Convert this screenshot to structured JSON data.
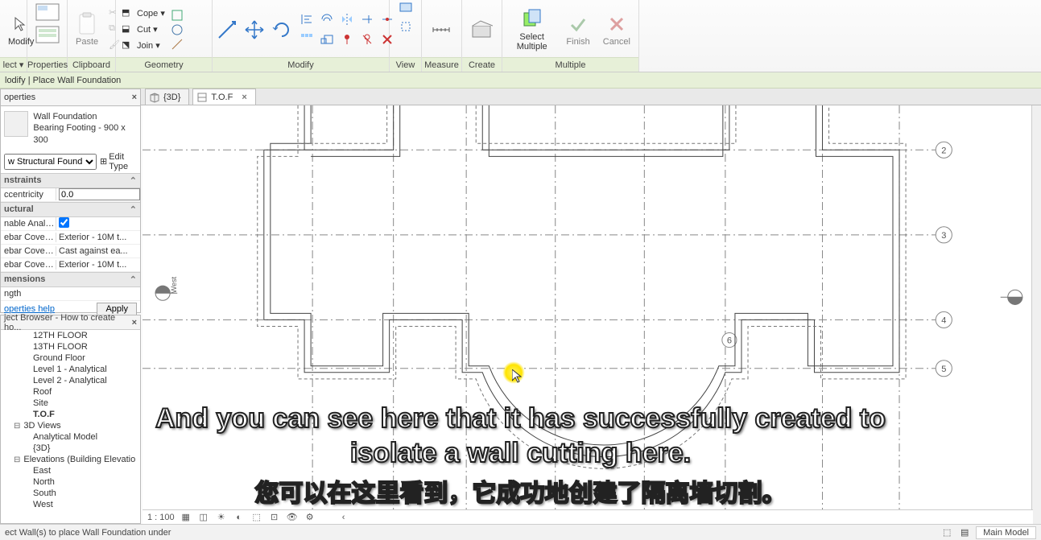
{
  "ribbon": {
    "groups": {
      "select": {
        "label": "lect ▾",
        "modify": "Modify"
      },
      "properties": {
        "label": "Properties"
      },
      "clipboard": {
        "label": "Clipboard",
        "paste": "Paste"
      },
      "geometry": {
        "label": "Geometry",
        "cope": "Cope ▾",
        "cut": "Cut ▾",
        "join": "Join ▾"
      },
      "modify": {
        "label": "Modify"
      },
      "view": {
        "label": "View"
      },
      "measure": {
        "label": "Measure"
      },
      "create": {
        "label": "Create"
      },
      "multiple": {
        "label": "Multiple",
        "select": "Select Multiple",
        "finish": "Finish",
        "cancel": "Cancel"
      }
    }
  },
  "context": "lodify | Place Wall Foundation",
  "tabs": [
    {
      "label": "{3D}",
      "icon": "cube",
      "active": false,
      "closable": false
    },
    {
      "label": "T.O.F",
      "icon": "plan",
      "active": true,
      "closable": true
    }
  ],
  "properties_panel": {
    "title": "operties",
    "type_name": "Wall Foundation",
    "type_sub": "Bearing Footing - 900 x 300",
    "selector": "w Structural Found",
    "edit_type": "Edit Type",
    "categories": [
      {
        "name": "nstraints",
        "rows": [
          {
            "k": "ccentricity",
            "v": "0.0",
            "input": true
          }
        ]
      },
      {
        "name": "uctural",
        "rows": [
          {
            "k": "nable Analyti...",
            "v": "",
            "checkbox": true,
            "checked": true
          },
          {
            "k": "ebar Cover - ...",
            "v": "Exterior - 10M t..."
          },
          {
            "k": "ebar Cover - ...",
            "v": "Cast against ea..."
          },
          {
            "k": "ebar Cover - ...",
            "v": "Exterior - 10M t..."
          }
        ]
      },
      {
        "name": "mensions",
        "rows": [
          {
            "k": "ngth",
            "v": ""
          }
        ]
      }
    ],
    "help": "operties help",
    "apply": "Apply"
  },
  "browser": {
    "title": "ject Browser - How to create ho...",
    "items": [
      {
        "type": "item",
        "label": "12TH FLOOR"
      },
      {
        "type": "item",
        "label": "13TH FLOOR"
      },
      {
        "type": "item",
        "label": "Ground Floor"
      },
      {
        "type": "item",
        "label": "Level 1 - Analytical"
      },
      {
        "type": "item",
        "label": "Level 2 - Analytical"
      },
      {
        "type": "item",
        "label": "Roof"
      },
      {
        "type": "item",
        "label": "Site"
      },
      {
        "type": "item",
        "label": "T.O.F",
        "bold": true
      },
      {
        "type": "group",
        "label": "3D Views"
      },
      {
        "type": "item",
        "label": "Analytical Model"
      },
      {
        "type": "item",
        "label": "{3D}"
      },
      {
        "type": "group",
        "label": "Elevations (Building Elevatio"
      },
      {
        "type": "item",
        "label": "East"
      },
      {
        "type": "item",
        "label": "North"
      },
      {
        "type": "item",
        "label": "South"
      },
      {
        "type": "item",
        "label": "West"
      }
    ]
  },
  "view_ctrl": {
    "scale": "1 : 100"
  },
  "grid_labels": {
    "g2": "2",
    "g3": "3",
    "g4": "4",
    "g5": "5",
    "g6": "6"
  },
  "status": {
    "hint": "ect Wall(s) to place Wall Foundation under",
    "model": "Main Model"
  },
  "subtitle_en": "And you can see here that it has successfully created to isolate a wall cutting here.",
  "subtitle_cn": "您可以在这里看到，它成功地创建了隔离墙切割。"
}
